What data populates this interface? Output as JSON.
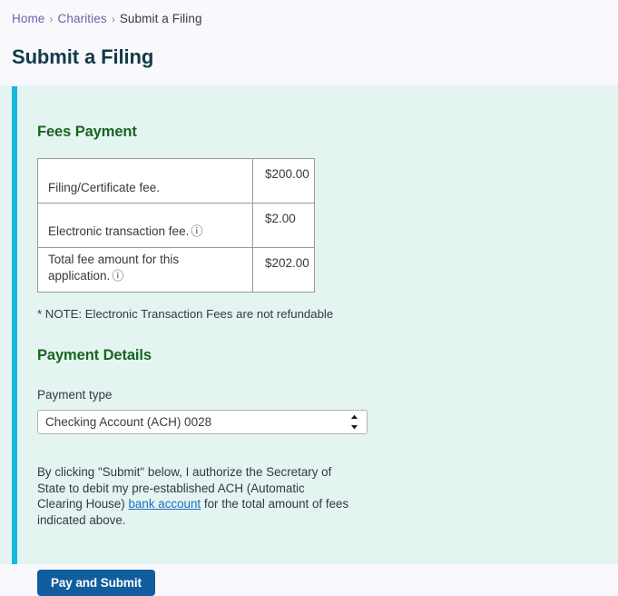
{
  "breadcrumb": {
    "items": [
      {
        "label": "Home",
        "link": true
      },
      {
        "label": "Charities",
        "link": true
      },
      {
        "label": "Submit a Filing",
        "link": false
      }
    ],
    "separator": "›"
  },
  "page": {
    "title": "Submit a Filing"
  },
  "fees_section": {
    "heading": "Fees Payment",
    "rows": [
      {
        "label": "Filing/Certificate fee.",
        "amount": "$200.00",
        "help": false
      },
      {
        "label": "Electronic transaction fee.",
        "amount": "$2.00",
        "help": true
      },
      {
        "label": "Total fee amount for this application.",
        "amount": "$202.00",
        "help": true
      }
    ],
    "help_icon_glyph": "ⓘ",
    "note": "* NOTE: Electronic Transaction Fees are not refundable"
  },
  "payment_details": {
    "heading": "Payment Details",
    "payment_type_label": "Payment type",
    "payment_type_value": "Checking Account (ACH) 0028",
    "payment_type_options": [
      "Checking Account (ACH) 0028"
    ]
  },
  "authorization": {
    "text_before_link": "By clicking \"Submit\" below, I authorize the Secretary of State to debit my pre-established ACH (Automatic Clearing House) ",
    "link_text": "bank account",
    "text_after_link": " for the total amount of fees indicated above."
  },
  "actions": {
    "submit_label": "Pay and Submit"
  },
  "colors": {
    "page_background": "#f9f8fc",
    "card_background": "#e4f4f1",
    "accent_bar": "#17b8df",
    "title": "#123a47",
    "section_heading": "#17661c",
    "breadcrumb_link": "#6f5fa8",
    "link": "#1b6ec2",
    "button": "#115d9e"
  }
}
